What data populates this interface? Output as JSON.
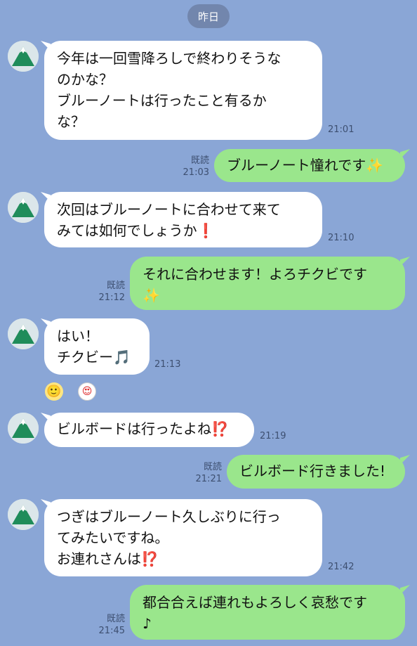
{
  "date_label": "昨日",
  "colors": {
    "background": "#8aa6d6",
    "incoming_bubble": "#ffffff",
    "outgoing_bubble": "#9ae68c"
  },
  "icons": {
    "avatar": "mountain-avatar-icon",
    "reaction_1": "smile-face-icon",
    "reaction_2": "heart-eyes-face-icon"
  },
  "messages": [
    {
      "lines": [
        "今年は一回雪降ろしで終わりそうな",
        "のかな？",
        "ブルーノートは行ったこと有るか",
        "な？"
      ],
      "time": "21:01"
    },
    {
      "lines": [
        "ブルーノート憧れです✨"
      ],
      "read": "既読",
      "time": "21:03"
    },
    {
      "lines": [
        "次回はブルーノートに合わせて来て",
        "みては如何でしょうか❗"
      ],
      "time": "21:10"
    },
    {
      "lines": [
        "それに合わせます！よろチクビです",
        "✨"
      ],
      "read": "既読",
      "time": "21:12"
    },
    {
      "lines": [
        "はい！",
        "チクビー🎵"
      ],
      "time": "21:13",
      "reactions": [
        "🙂",
        "😍"
      ]
    },
    {
      "lines": [
        "ビルボードは行ったよね⁉️"
      ],
      "time": "21:19"
    },
    {
      "lines": [
        "ビルボード行きました!"
      ],
      "read": "既読",
      "time": "21:21"
    },
    {
      "lines": [
        "つぎはブルーノート久しぶりに行っ",
        "てみたいですね。",
        "お連れさんは⁉️"
      ],
      "time": "21:42"
    },
    {
      "lines": [
        "都合合えば連れもよろしく哀愁です",
        "♪"
      ],
      "read": "既読",
      "time": "21:45"
    }
  ]
}
